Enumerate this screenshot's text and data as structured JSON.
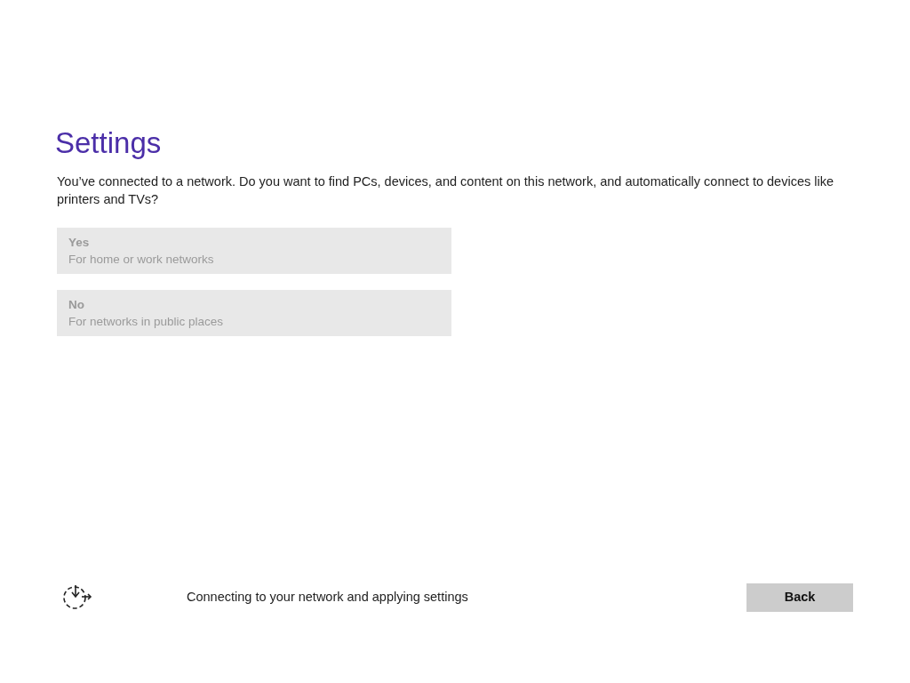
{
  "title": "Settings",
  "question": "You’ve connected to a network. Do you want to find PCs, devices, and content on this network, and automatically connect to devices like printers and TVs?",
  "options": [
    {
      "label": "Yes",
      "description": "For home or work networks",
      "disabled": true
    },
    {
      "label": "No",
      "description": "For networks in public places",
      "disabled": true
    }
  ],
  "status": "Connecting to your network and applying settings",
  "buttons": [
    {
      "label": "Back",
      "disabled": false
    }
  ]
}
